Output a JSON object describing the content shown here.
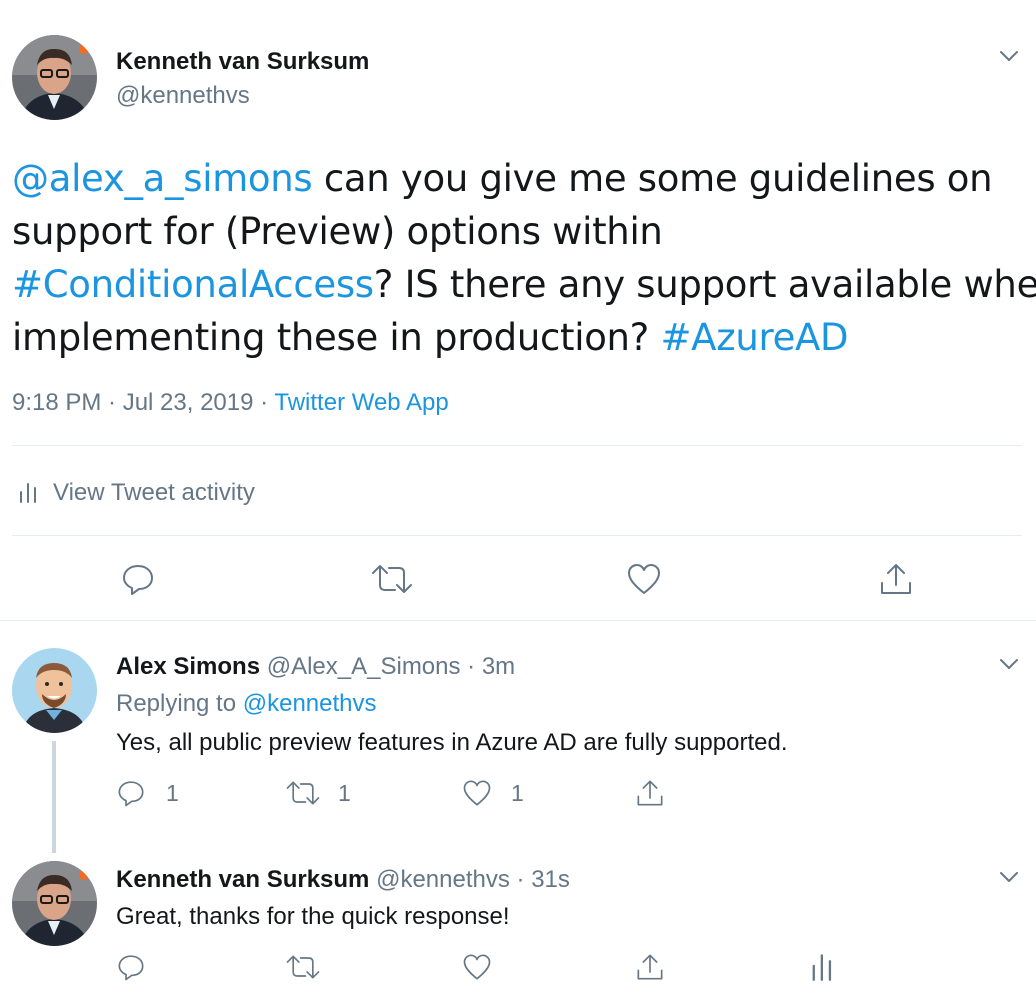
{
  "main_tweet": {
    "author_name": "Kenneth van Surksum",
    "author_handle": "@kennethvs",
    "mention": "@alex_a_simons",
    "text_1": " can you give me some guidelines on",
    "text_2": "support for (Preview) options within",
    "hashtag_1": "#ConditionalAccess",
    "text_3": "? IS there any support available when",
    "text_4": "implementing these in production? ",
    "hashtag_2": "#AzureAD",
    "time": "9:18 PM · Jul 23, 2019",
    "separator": " · ",
    "source": "Twitter Web App",
    "activity_label": "View Tweet activity"
  },
  "replies": [
    {
      "author_name": "Alex Simons",
      "author_handle": "@Alex_A_Simons",
      "time": "· 3m",
      "replying_prefix": "Replying to ",
      "replying_to": "@kennethvs",
      "text": "Yes, all public preview features in Azure AD are fully supported.",
      "reply_count": "1",
      "retweet_count": "1",
      "like_count": "1"
    },
    {
      "author_name": "Kenneth van Surksum",
      "author_handle": "@kennethvs",
      "time": "· 31s",
      "text": "Great, thanks for the quick response!"
    }
  ],
  "icons": {
    "reply": "reply-icon",
    "retweet": "retweet-icon",
    "like": "like-icon",
    "share": "share-icon",
    "analytics": "analytics-icon",
    "more": "chevron-down-icon"
  },
  "colors": {
    "link": "#1b95e0",
    "muted": "#657786",
    "divider": "#e6ecf0",
    "thread_line": "#ccd6dd"
  }
}
